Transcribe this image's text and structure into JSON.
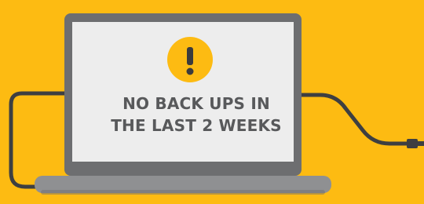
{
  "alert": {
    "line1": "NO BACK UPS IN",
    "line2": "THE LAST 2 WEEKS",
    "symbol": "!",
    "icon": "warning-exclamation-icon"
  },
  "colors": {
    "background": "#FDBB12",
    "laptop_frame": "#6D6E70",
    "screen": "#EDEDED",
    "base": "#8F9092",
    "base_shadow": "#6D6E70",
    "text": "#58595B",
    "icon_circle": "#FDBB12",
    "cable": "#3E3F41"
  }
}
